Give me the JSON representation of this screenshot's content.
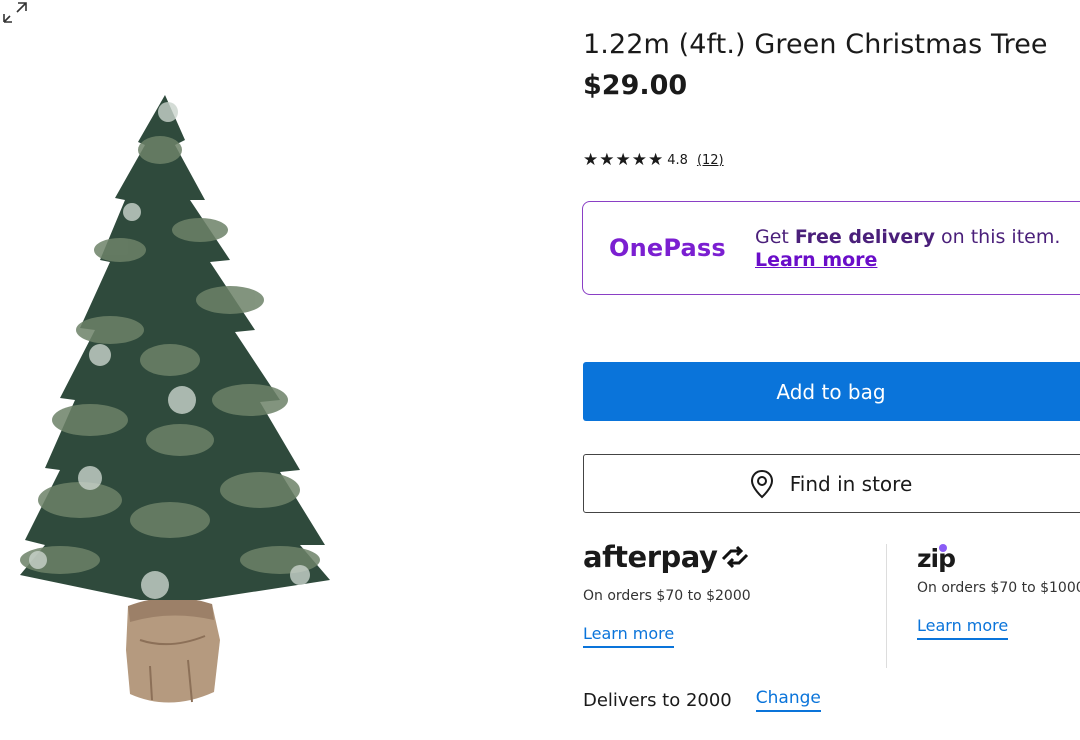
{
  "product": {
    "title": "1.22m (4ft.) Green Christmas Tree",
    "price": "$29.00",
    "rating_value": "4.8",
    "review_count": "(12)",
    "stars": 5,
    "image_alt_icon": "christmas-tree-image"
  },
  "onepass": {
    "logo": "OnePass",
    "text_prefix": "Get ",
    "text_bold": "Free delivery",
    "text_suffix": " on this item. ",
    "link_label": "Learn more"
  },
  "actions": {
    "add_to_bag": "Add to bag",
    "find_in_store": "Find in store",
    "find_icon": "location-pin-icon"
  },
  "payments": {
    "afterpay": {
      "logo": "afterpay",
      "description": "On orders $70 to $2000",
      "link_label": "Learn more"
    },
    "zip": {
      "logo": "zip",
      "description": "On orders $70 to $1000",
      "link_label": "Learn more"
    }
  },
  "delivery": {
    "text": "Delivers to 2000",
    "change_label": "Change"
  },
  "colors": {
    "primary_blue": "#0a74da",
    "onepass_purple": "#7b1fd1",
    "zip_purple": "#8a5cf6"
  }
}
